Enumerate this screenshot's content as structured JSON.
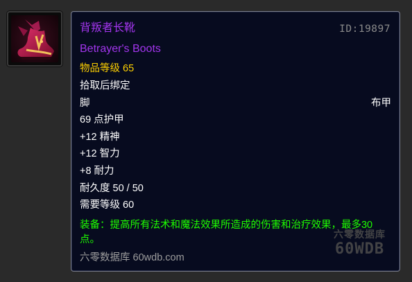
{
  "item": {
    "name_cn": "背叛者长靴",
    "name_en": "Betrayer's Boots",
    "id_label": "ID:19897",
    "item_level": "物品等级 65",
    "bind": "拾取后绑定",
    "slot": "脚",
    "armor_type": "布甲",
    "armor": "69 点护甲",
    "stats": [
      "+12 精神",
      "+12 智力",
      "+8 耐力"
    ],
    "durability": "耐久度 50 / 50",
    "required_level": "需要等级 60",
    "equip_effect": "装备：提高所有法术和魔法效果所造成的伤害和治疗效果，最多30点。",
    "source": "六零数据库 60wdb.com",
    "icon": "boots-icon"
  },
  "watermark": {
    "line1": "六零数据库",
    "line2": "60WDB"
  },
  "colors": {
    "epic_purple": "#a335ee",
    "item_level_gold": "#ffd100",
    "equip_green": "#1eff00",
    "tooltip_bg": "#070b1f",
    "muted_gray": "#9d9d9d"
  }
}
